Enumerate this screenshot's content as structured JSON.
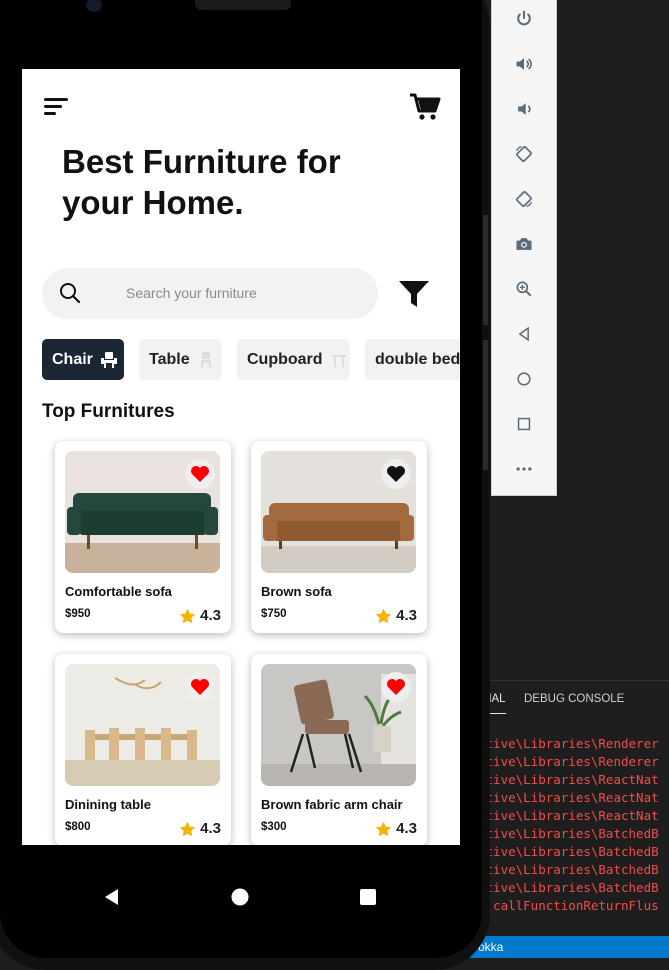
{
  "app": {
    "title_line1": "Best Furniture for",
    "title_line2": "your Home.",
    "search": {
      "placeholder": "Search your furniture"
    },
    "categories": [
      {
        "label": "Chair",
        "active": true
      },
      {
        "label": "Table",
        "active": false
      },
      {
        "label": "Cupboard",
        "active": false
      },
      {
        "label": "double bed",
        "active": false
      }
    ],
    "section_title": "Top Furnitures",
    "products": [
      {
        "name": "Comfortable sofa",
        "price": "$950",
        "rating": "4.3",
        "favorite": true
      },
      {
        "name": "Brown sofa",
        "price": "$750",
        "rating": "4.3",
        "favorite": false
      },
      {
        "name": "Dinining table",
        "price": "$800",
        "rating": "4.3",
        "favorite": true
      },
      {
        "name": "Brown fabric arm chair",
        "price": "$300",
        "rating": "4.3",
        "favorite": true
      }
    ]
  },
  "vscode": {
    "panel_tabs": [
      "INAL",
      "DEBUG CONSOLE"
    ],
    "terminal_lines": [
      "ative\\Libraries\\Renderer",
      "ative\\Libraries\\Renderer",
      "ative\\Libraries\\ReactNat",
      "ative\\Libraries\\ReactNat",
      "ative\\Libraries\\ReactNat",
      "ative\\Libraries\\BatchedB",
      "ative\\Libraries\\BatchedB",
      "ative\\Libraries\\BatchedB",
      "ative\\Libraries\\BatchedB",
      "n callFunctionReturnFlus"
    ],
    "status_text": "okka"
  },
  "colors": {
    "chip_active": "#1c2735",
    "heart_red": "#ff0000",
    "star": "#f5b400",
    "status_bar": "#007acc",
    "terminal_error": "#f14c4c"
  },
  "icons": [
    "menu-icon",
    "cart-icon",
    "search-icon",
    "filter-icon",
    "chair-icon",
    "table-icon",
    "heart-icon",
    "star-icon",
    "back-icon",
    "home-icon",
    "recents-icon",
    "power-icon",
    "volume-up-icon",
    "volume-down-icon",
    "rotate-left-icon",
    "rotate-right-icon",
    "camera-icon",
    "zoom-icon",
    "more-icon"
  ]
}
